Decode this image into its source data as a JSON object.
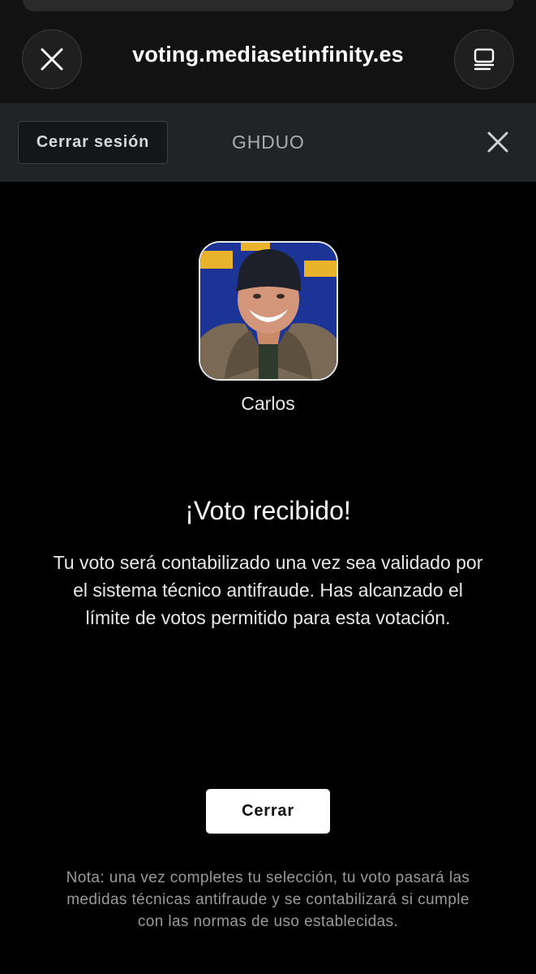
{
  "browser": {
    "url": "voting.mediasetinfinity.es",
    "close_icon": "close-icon",
    "tabs_icon": "tabs-overview-icon"
  },
  "header": {
    "logout_label": "Cerrar sesión",
    "user_code": "GHDUO",
    "close_icon": "close-icon"
  },
  "contestant": {
    "name": "Carlos"
  },
  "confirmation": {
    "title": "¡Voto recibido!",
    "message": "Tu voto será contabilizado una vez sea validado por el sistema técnico antifraude. Has alcanzado el límite de votos permitido para esta votación.",
    "close_label": "Cerrar"
  },
  "note": "Nota: una vez completes tu selección, tu voto pasará las medidas técnicas antifraude y se contabilizará si cumple con las normas de uso establecidas.",
  "colors": {
    "background": "#000000",
    "header_bar": "#212426",
    "primary_button": "#ffffff"
  }
}
